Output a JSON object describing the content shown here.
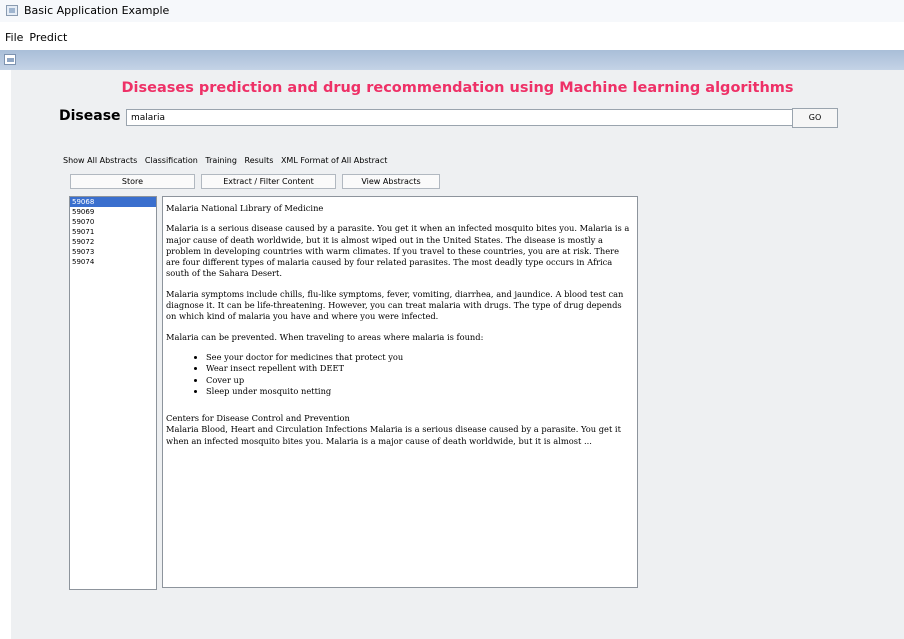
{
  "window": {
    "title": "Basic Application Example"
  },
  "menu": [
    "File",
    "Predict"
  ],
  "header": {
    "title": "Diseases prediction and drug recommendation using Machine learning algorithms"
  },
  "search": {
    "label": "Disease",
    "value": "malaria",
    "go_label": "GO"
  },
  "tabs": [
    "Show All Abstracts",
    "Classification",
    "Training",
    "Results",
    "XML Format of All Abstract"
  ],
  "toolbar": {
    "store": "Store",
    "extract": "Extract / Filter Content",
    "view": "View Abstracts"
  },
  "list": {
    "items": [
      "59068",
      "59069",
      "59070",
      "59071",
      "59072",
      "59073",
      "59074"
    ],
    "selected_index": 0
  },
  "abstract": {
    "heading": "Malaria National Library of Medicine",
    "para1": "Malaria is a serious disease caused by a parasite. You get it when an infected mosquito bites you. Malaria is a major cause of death worldwide, but it is almost wiped out in the United States. The disease is mostly a problem in developing countries with warm climates. If you travel to these countries, you are at risk. There are four different types of malaria caused by four related parasites. The most deadly type occurs in Africa south of the Sahara Desert.",
    "para2": "Malaria symptoms include chills, flu-like symptoms, fever, vomiting, diarrhea, and jaundice. A blood test can diagnose it. It can be life-threatening. However, you can treat malaria with drugs. The type of drug depends on which kind of malaria you have and where you were infected.",
    "para3": "Malaria can be prevented. When traveling to areas where malaria is found:",
    "bullets": [
      "See your doctor for medicines that protect you",
      "Wear insect repellent with DEET",
      "Cover up",
      "Sleep under mosquito netting"
    ],
    "source_heading": "Centers for Disease Control and Prevention",
    "para4": "Malaria Blood, Heart and Circulation Infections Malaria is a serious disease caused by a parasite. You get it when an infected mosquito bites you. Malaria is a major cause of death worldwide, but it is almost ..."
  },
  "colors": {
    "heading": "#ee3167",
    "selection": "#3a6fce",
    "frame_header": "#b4c7df",
    "panel_bg": "#eef0f2"
  },
  "icons": [
    "app-icon",
    "internal-frame-icon"
  ]
}
